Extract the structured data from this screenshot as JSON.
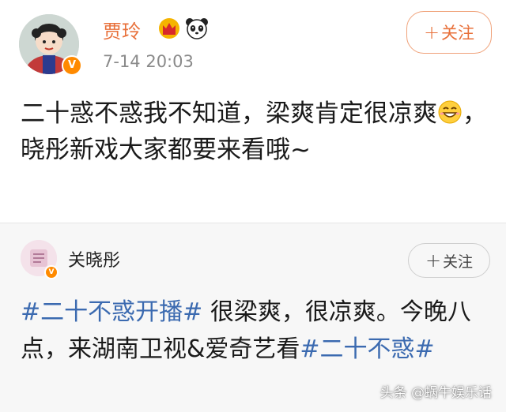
{
  "post": {
    "author_name": "贾玲",
    "timestamp": "7-14 20:03",
    "follow_label": "关注",
    "follow_plus": "+",
    "text_part1": "二十惑不惑我不知道，梁爽肯定很凉爽",
    "text_part2": "，晓彤新戏大家都要来看哦~",
    "verified_badge": "V",
    "icons": [
      "crown-icon",
      "panda-icon",
      "grin-emoji-icon"
    ]
  },
  "repost": {
    "author_name": "关晓彤",
    "follow_label": "关注",
    "follow_plus": "+",
    "hashtag1": "#二十不惑开播#",
    "text_middle": " 很梁爽，很凉爽。今晚八点，来湖南卫视&爱奇艺看",
    "hashtag2": "#二十不惑#",
    "verified_badge": "V"
  },
  "watermark": "头条 @蜗牛娱乐话",
  "colors": {
    "author_orange": "#e8703a",
    "hashtag_blue": "#3b6ab0",
    "badge_orange": "#ff8a00"
  }
}
